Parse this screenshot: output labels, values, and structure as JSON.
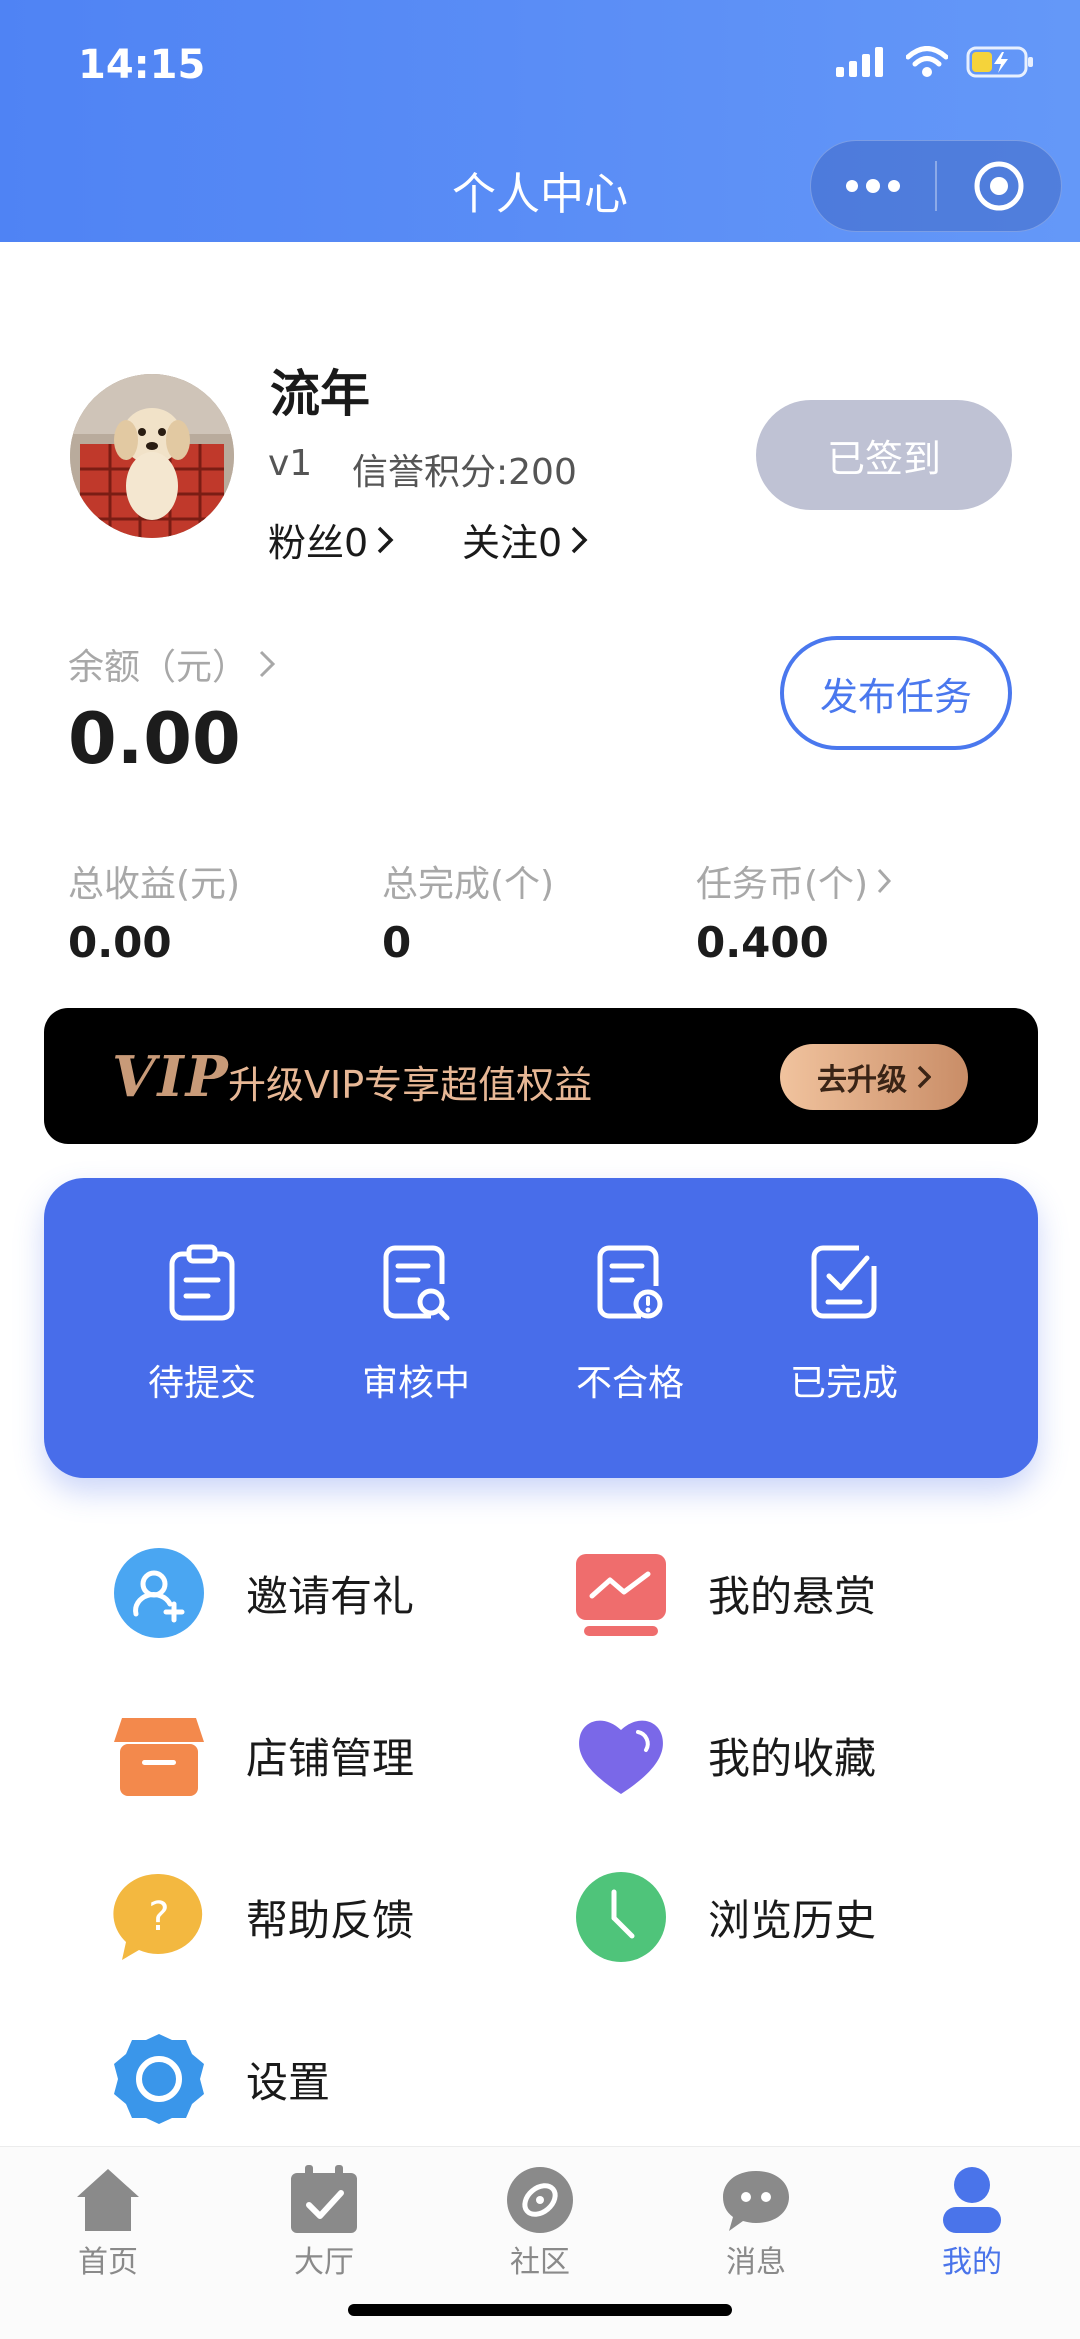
{
  "status_bar": {
    "time": "14:15"
  },
  "header": {
    "title": "个人中心"
  },
  "profile": {
    "nickname": "流年",
    "level": "v1",
    "credit": "信誉积分:200",
    "fans": "粉丝0",
    "follow": "关注0",
    "sign_label": "已签到"
  },
  "balance": {
    "label": "余额（元）",
    "value": "0.00",
    "publish_label": "发布任务"
  },
  "stats": [
    {
      "label": "总收益(元)",
      "value": "0.00"
    },
    {
      "label": "总完成(个)",
      "value": "0"
    },
    {
      "label": "任务币(个)",
      "value": "0.400"
    }
  ],
  "vip": {
    "logo": "VIP",
    "text": "升级VIP专享超值权益",
    "button": "去升级"
  },
  "task_status": [
    {
      "label": "待提交",
      "icon": "clipboard-icon"
    },
    {
      "label": "审核中",
      "icon": "document-search-icon"
    },
    {
      "label": "不合格",
      "icon": "document-alert-icon"
    },
    {
      "label": "已完成",
      "icon": "document-check-icon"
    }
  ],
  "menu": [
    {
      "label": "邀请有礼",
      "icon": "invite-user-icon",
      "color": "#4aa6f2"
    },
    {
      "label": "我的悬赏",
      "icon": "reward-chart-icon",
      "color": "#ef6d6d"
    },
    {
      "label": "店铺管理",
      "icon": "shop-icon",
      "color": "#f3894c"
    },
    {
      "label": "我的收藏",
      "icon": "heart-icon",
      "color": "#7a68e8"
    },
    {
      "label": "帮助反馈",
      "icon": "help-bubble-icon",
      "color": "#f3b840"
    },
    {
      "label": "浏览历史",
      "icon": "clock-icon",
      "color": "#4fc47a"
    },
    {
      "label": "设置",
      "icon": "gear-icon",
      "color": "#3a96ea"
    }
  ],
  "tabs": [
    {
      "label": "首页",
      "icon": "home-icon"
    },
    {
      "label": "大厅",
      "icon": "calendar-check-icon"
    },
    {
      "label": "社区",
      "icon": "compass-icon"
    },
    {
      "label": "消息",
      "icon": "chat-icon"
    },
    {
      "label": "我的",
      "icon": "user-icon",
      "active": true
    }
  ],
  "colors": {
    "header": "#5c8ff6",
    "accent": "#4a74ea",
    "task_card": "#486dea",
    "vip_gold": "#e7b795"
  }
}
